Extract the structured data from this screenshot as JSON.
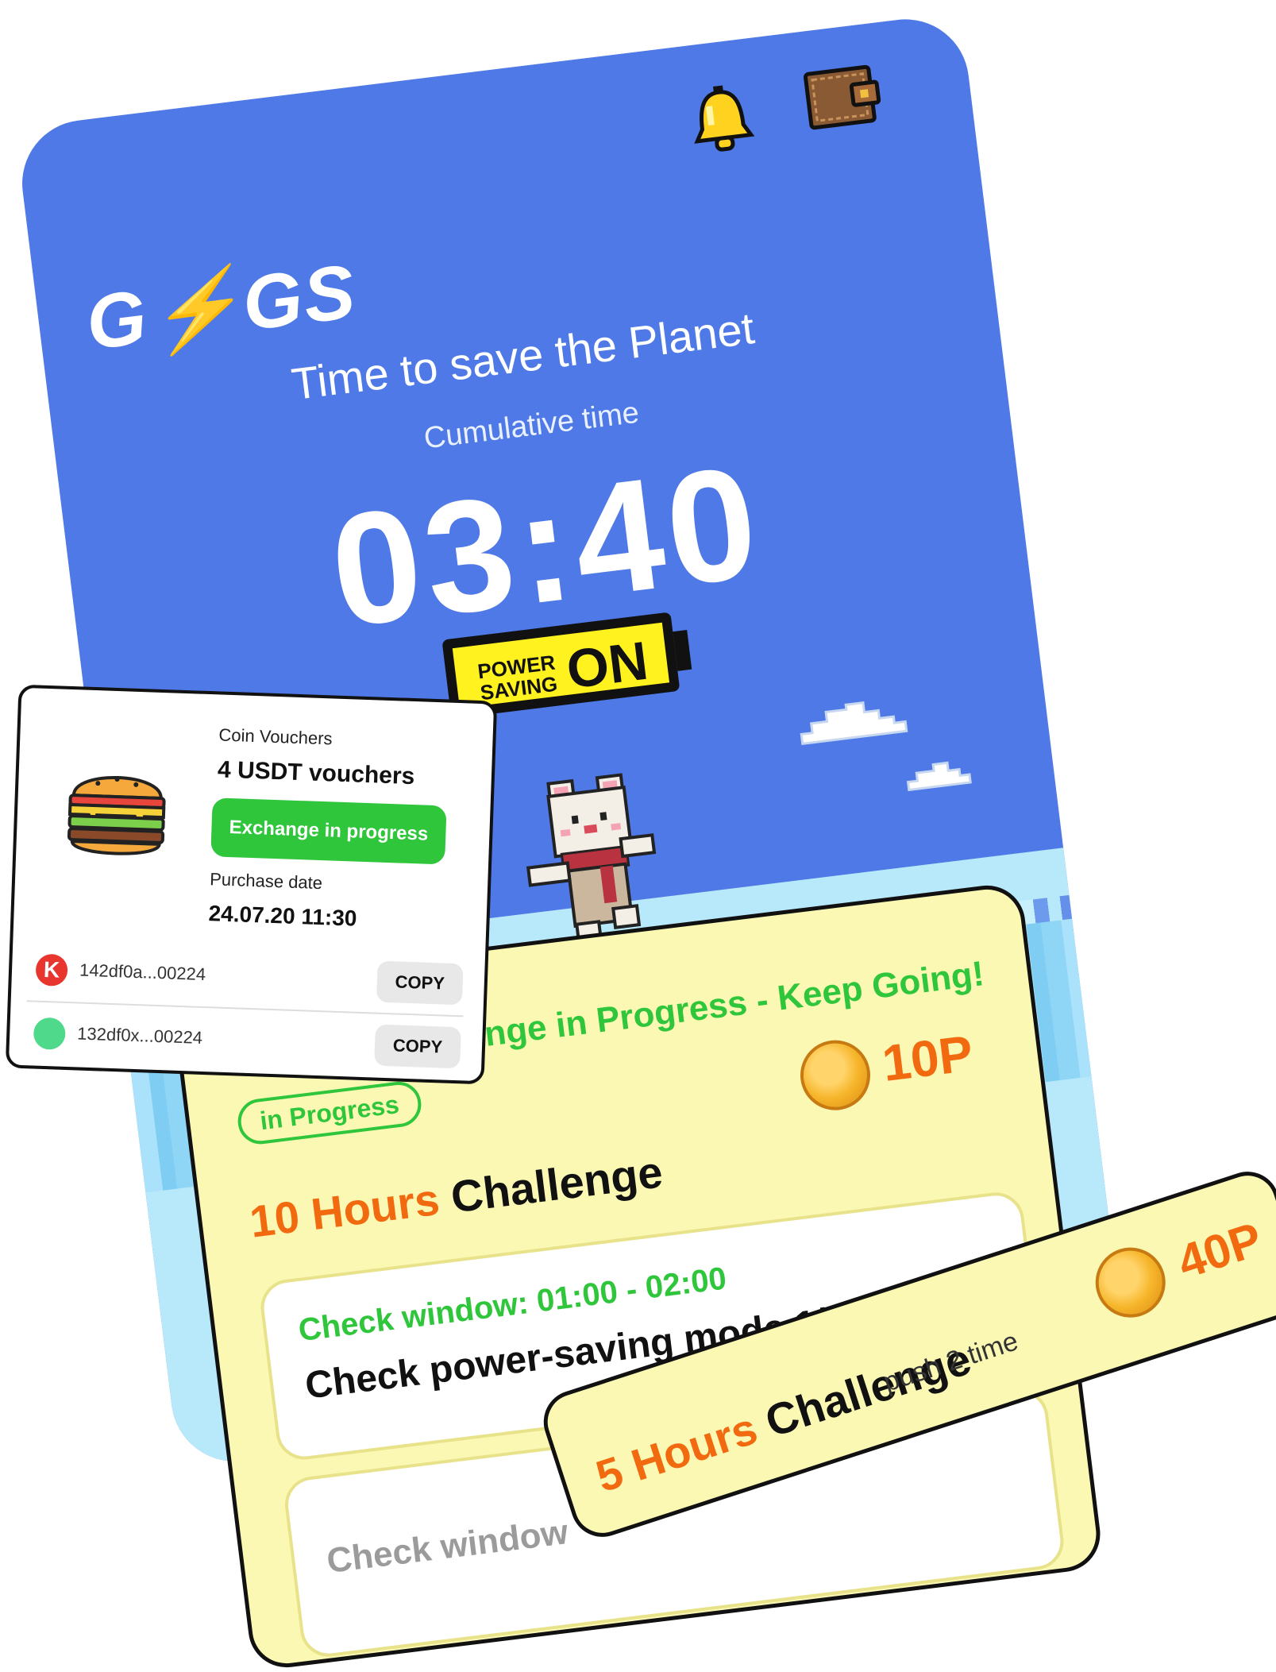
{
  "app": {
    "logo": "G⚡GS",
    "headline": "Time to save the Planet",
    "cumulative_label": "Cumulative time",
    "timer": "03:40",
    "power_saving_small": "POWER SAVING",
    "power_saving_state": "ON"
  },
  "icons": {
    "notification": "bell-icon",
    "wallet": "wallet-icon",
    "coin": "coin-icon"
  },
  "challenge": {
    "progress_title": "Challenge in Progress - Keep Going!",
    "status_pill": "in Progress",
    "points": "10P",
    "title_hours": "10 Hours",
    "title_word": "Challenge",
    "task1": {
      "window": "Check window: 01:00 - 02:00",
      "text": "Check power-saving mode 1/3"
    },
    "task2": {
      "window": "Check window"
    }
  },
  "five_hours": {
    "title_hours": "5 Hours",
    "title_word": "Challenge",
    "push": "push 2 time",
    "points": "40P"
  },
  "voucher": {
    "label": "Coin Vouchers",
    "title": "4 USDT vouchers",
    "status_button": "Exchange in progress",
    "purchase_label": "Purchase date",
    "purchase_date": "24.07.20 11:30",
    "wallets": [
      {
        "address": "142df0a...00224",
        "copy": "COPY"
      },
      {
        "address": "132df0x...00224",
        "copy": "COPY"
      }
    ]
  },
  "colors": {
    "sky": "#4f79e6",
    "ice": "#b7e9fb",
    "panel": "#fbf8b4",
    "green": "#2fc63c",
    "orange": "#f26a10",
    "battery": "#fff21e"
  }
}
